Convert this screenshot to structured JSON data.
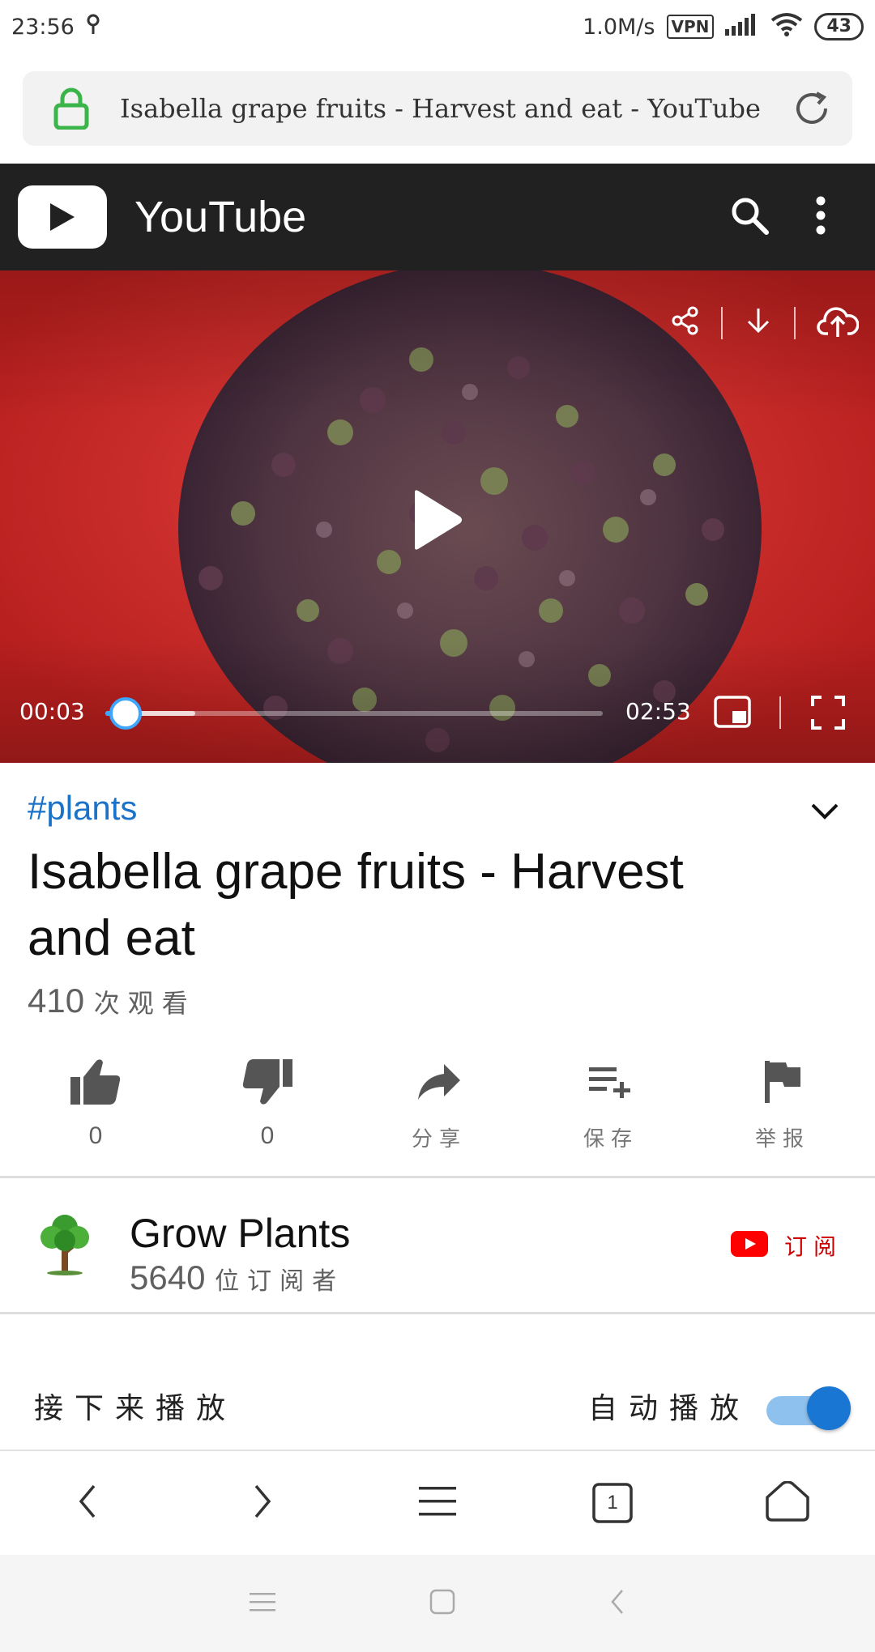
{
  "status_bar": {
    "time": "23:56",
    "net_speed": "1.0M/s",
    "vpn": "VPN",
    "battery": "43"
  },
  "address_bar": {
    "url_title": "Isabella grape fruits - Harvest and eat - YouTube"
  },
  "youtube_header": {
    "brand": "YouTube"
  },
  "player": {
    "current_time": "00:03",
    "total_time": "02:53",
    "played_fraction": 0.04,
    "buffered_fraction": 0.18
  },
  "video": {
    "hashtag": "#plants",
    "title": "Isabella grape fruits - Harvest and eat",
    "views_count": "410",
    "views_suffix": "次观看"
  },
  "actions": {
    "like_count": "0",
    "dislike_count": "0",
    "share_label": "分享",
    "save_label": "保存",
    "report_label": "举报"
  },
  "channel": {
    "name": "Grow Plants",
    "subscriber_count": "5640",
    "subscriber_suffix": "位订阅者",
    "subscribe_label": "订阅"
  },
  "up_next": {
    "label": "接下来播放",
    "autoplay_label": "自动播放",
    "autoplay_on": true
  },
  "browser_nav": {
    "tab_count": "1"
  },
  "colors": {
    "youtube_red": "#ff0000",
    "header_bg": "#212121",
    "link_blue": "#1a73c8",
    "accent_blue": "#3ea6ff",
    "toggle_blue": "#1976d2",
    "lock_green": "#3bb54a"
  }
}
